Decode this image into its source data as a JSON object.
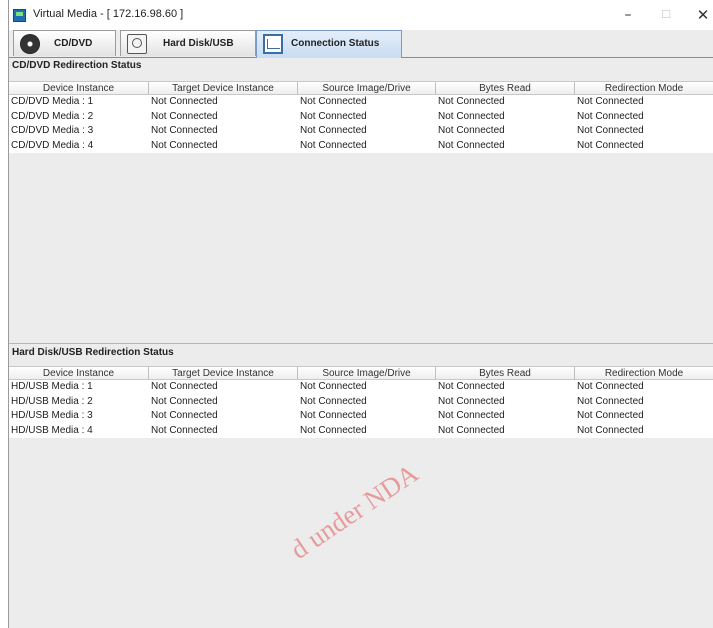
{
  "window": {
    "title": "Virtual Media - [ 172.16.98.60 ]"
  },
  "tabs": [
    {
      "label": "CD/DVD",
      "icon": "cd-icon"
    },
    {
      "label": "Hard Disk/USB",
      "icon": "hard-disk-icon"
    },
    {
      "label": "Connection Status",
      "icon": "connection-status-icon"
    }
  ],
  "cd_section": {
    "title": "CD/DVD Redirection Status",
    "columns": [
      "Device Instance",
      "Target Device Instance",
      "Source Image/Drive",
      "Bytes Read",
      "Redirection Mode"
    ],
    "rows": [
      [
        "CD/DVD Media :  1",
        "Not Connected",
        "Not Connected",
        "Not Connected",
        "Not Connected"
      ],
      [
        "CD/DVD Media :  2",
        "Not Connected",
        "Not Connected",
        "Not Connected",
        "Not Connected"
      ],
      [
        "CD/DVD Media :  3",
        "Not Connected",
        "Not Connected",
        "Not Connected",
        "Not Connected"
      ],
      [
        "CD/DVD Media :  4",
        "Not Connected",
        "Not Connected",
        "Not Connected",
        "Not Connected"
      ]
    ]
  },
  "hd_section": {
    "title": "Hard Disk/USB Redirection Status",
    "columns": [
      "Device Instance",
      "Target Device Instance",
      "Source Image/Drive",
      "Bytes Read",
      "Redirection Mode"
    ],
    "rows": [
      [
        "HD/USB Media :  1",
        "Not Connected",
        "Not Connected",
        "Not Connected",
        "Not Connected"
      ],
      [
        "HD/USB Media :  2",
        "Not Connected",
        "Not Connected",
        "Not Connected",
        "Not Connected"
      ],
      [
        "HD/USB Media :  3",
        "Not Connected",
        "Not Connected",
        "Not Connected",
        "Not Connected"
      ],
      [
        "HD/USB Media :  4",
        "Not Connected",
        "Not Connected",
        "Not Connected",
        "Not Connected"
      ]
    ]
  },
  "watermark": "d under NDA",
  "colors": {
    "active_tab": "#c9dcf2",
    "watermark": "#e15a5a"
  }
}
